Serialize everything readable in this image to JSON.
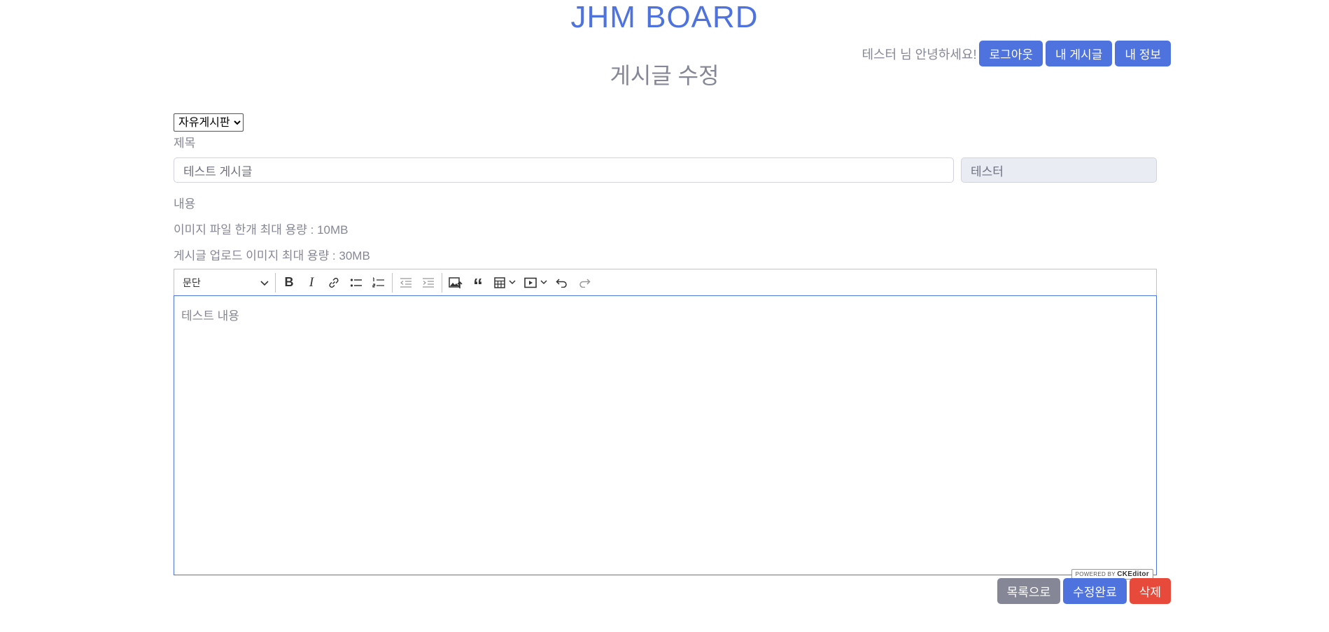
{
  "header": {
    "site_title": "JHM BOARD",
    "greeting": "테스터 님 안녕하세요!",
    "logout_label": "로그아웃",
    "my_posts_label": "내 게시글",
    "my_info_label": "내 정보"
  },
  "page_title": "게시글 수정",
  "form": {
    "board_selected": "자유게시판",
    "title_label": "제목",
    "title_value": "테스트 게시글",
    "author_value": "테스터",
    "content_label": "내용",
    "notice_file_limit": "이미지 파일 한개 최대 용량 : 10MB",
    "notice_total_limit": "게시글 업로드 이미지 최대 용량 : 30MB"
  },
  "editor": {
    "paragraph_label": "문단",
    "content": "테스트 내용",
    "powered_prefix": "POWERED BY",
    "powered_brand": "CKEditor",
    "tools": [
      "bold-icon",
      "italic-icon",
      "link-icon",
      "bulleted-list-icon",
      "numbered-list-icon",
      "outdent-icon",
      "indent-icon",
      "insert-image-icon",
      "block-quote-icon",
      "insert-table-icon",
      "media-embed-icon",
      "undo-icon",
      "redo-icon"
    ]
  },
  "actions": {
    "list_label": "목록으로",
    "save_label": "수정완료",
    "delete_label": "삭제"
  },
  "colors": {
    "primary": "#4e73df",
    "secondary": "#858796",
    "danger": "#e74a3b",
    "readonly_bg": "#eaecf4"
  }
}
